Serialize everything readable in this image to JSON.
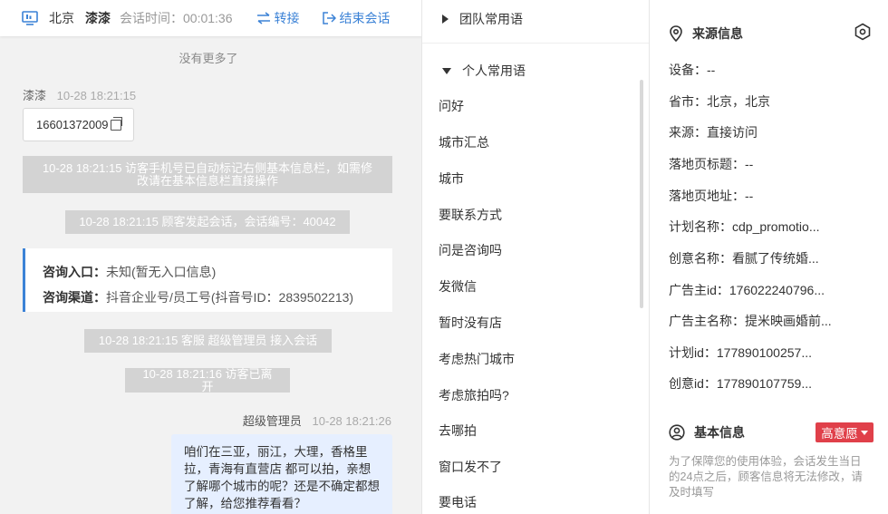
{
  "header": {
    "city": "北京",
    "visitor_name": "漆漆",
    "duration_label": "会话时间：",
    "duration_value": "00:01:36",
    "transfer_label": "转接",
    "end_label": "结束会话"
  },
  "chat": {
    "no_more": "没有更多了",
    "visitor_msg": {
      "name": "漆漆",
      "time": "10-28 18:21:15",
      "text": "16601372009"
    },
    "system_1_line1": "10-28 18:21:15 访客手机号已自动标记右侧基本信息栏，如需修",
    "system_1_line2": "改请在基本信息栏直接操作",
    "system_2": "10-28 18:21:15 顾客发起会话，会话编号：40042",
    "consult": {
      "entry_key": "咨询入口：",
      "entry_val": "未知(暂无入口信息)",
      "channel_key": "咨询渠道：",
      "channel_val": "抖音企业号/员工号(抖音号ID：2839502213)"
    },
    "system_3": "10-28 18:21:15 客服 超级管理员 接入会话",
    "system_4": "10-28 18:21:16 访客已离开",
    "agent_msg": {
      "name": "超级管理员",
      "time": "10-28 18:21:26",
      "line1": "咱们在三亚，丽江，大理，香格里",
      "line2": "拉，青海有直营店 都可以拍，亲想",
      "line3": "了解哪个城市的呢？还是不确定都想",
      "line4": "了解，给您推荐看看？"
    }
  },
  "phrases": {
    "team_group": "团队常用语",
    "personal_group": "个人常用语",
    "items": [
      "问好",
      "城市汇总",
      "城市",
      "要联系方式",
      "问是咨询吗",
      "发微信",
      "暂时没有店",
      "考虑热门城市",
      "考虑旅拍吗?",
      "去哪拍",
      "窗口发不了",
      "要电话"
    ]
  },
  "info": {
    "source_title": "来源信息",
    "rows": [
      "设备：--",
      "省市：北京，北京",
      "来源：直接访问",
      "落地页标题：--",
      "落地页地址：--",
      "计划名称：cdp_promotio...",
      "创意名称：看腻了传统婚...",
      "广告主id：176022240796...",
      "广告主名称：提米映画婚前...",
      "计划id：177890100257...",
      "创意id：177890107759..."
    ],
    "basic_title": "基本信息",
    "intent_label": "高意愿",
    "intent_color": "#e0404a",
    "notice": "为了保障您的使用体验，会话发生当日的24点之后，顾客信息将无法修改，请及时填写"
  },
  "colors": {
    "accent": "#3b82d6",
    "agent_bubble": "#e6efff",
    "system_bg": "#d3d3d3"
  }
}
